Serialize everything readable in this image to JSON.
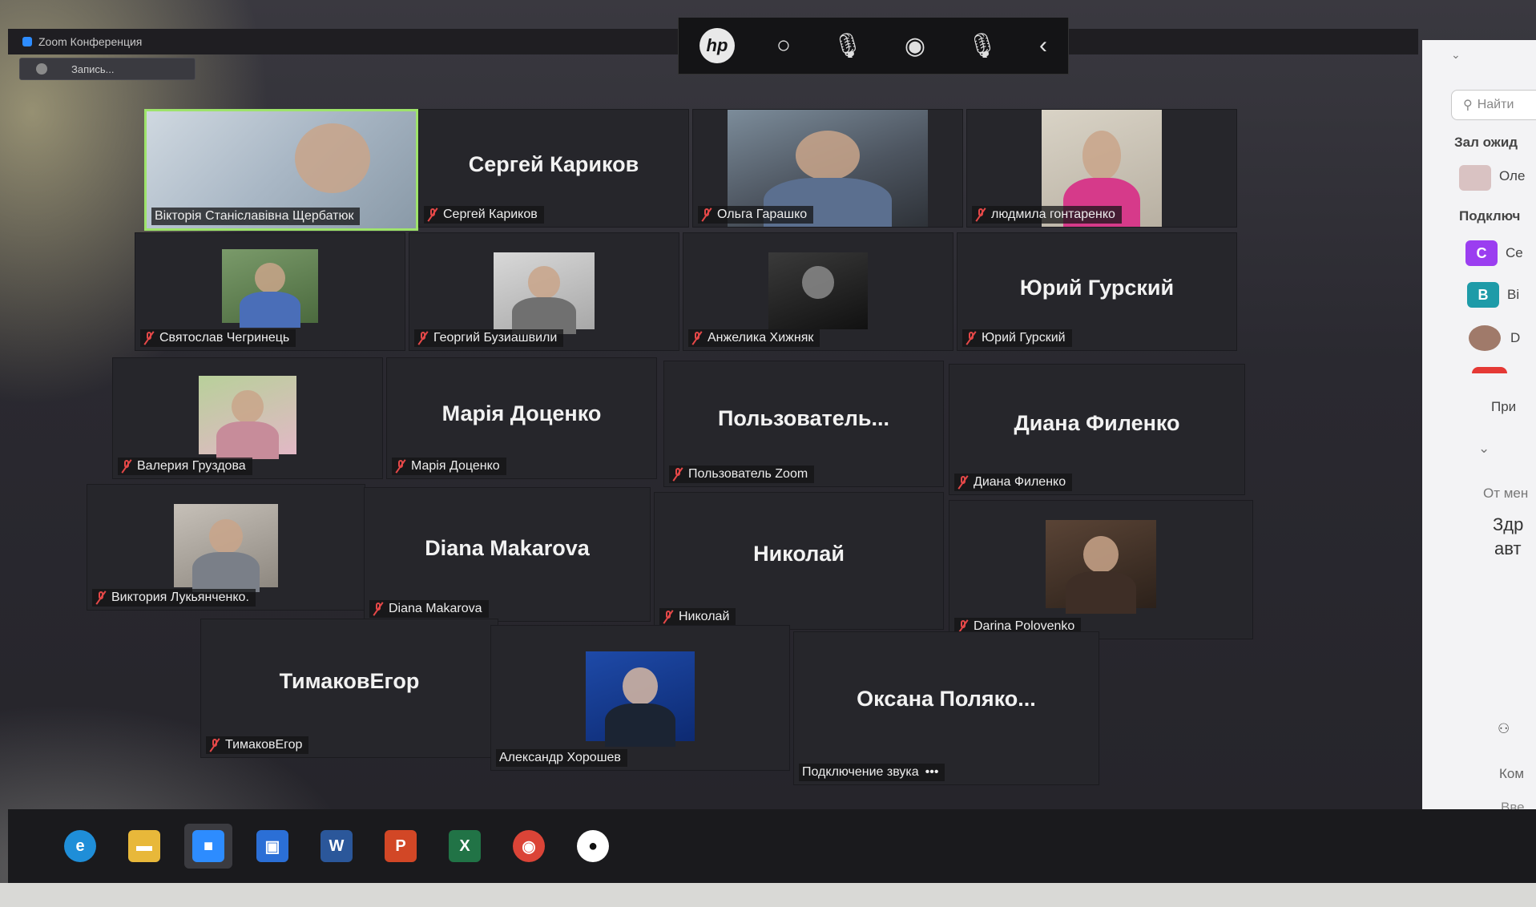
{
  "window": {
    "title": "Zoom Конференция",
    "recording_label": "Запись..."
  },
  "participants": [
    {
      "name": "Вікторія Станіславівна Щербатюк",
      "big_name": "",
      "has_video": true,
      "active_speaker": true,
      "muted": false
    },
    {
      "name": "Сергей Кариков",
      "big_name": "Сергей Кариков",
      "has_video": false,
      "muted": true
    },
    {
      "name": "Ольга Гарашко",
      "big_name": "",
      "has_video": true,
      "muted": true
    },
    {
      "name": "людмила гонтаренко",
      "big_name": "",
      "has_video": true,
      "muted": true
    },
    {
      "name": "Святослав Чегринець",
      "big_name": "",
      "has_video": true,
      "muted": true
    },
    {
      "name": "Георгий Бузиашвили",
      "big_name": "",
      "has_video": true,
      "muted": true
    },
    {
      "name": "Анжелика Хижняк",
      "big_name": "",
      "has_video": true,
      "muted": true
    },
    {
      "name": "Юрий Гурский",
      "big_name": "Юрий Гурский",
      "has_video": false,
      "muted": true
    },
    {
      "name": "Валерия Груздова",
      "big_name": "",
      "has_video": true,
      "muted": true
    },
    {
      "name": "Марія Доценко",
      "big_name": "Марія Доценко",
      "has_video": false,
      "muted": true
    },
    {
      "name": "Пользователь Zoom",
      "big_name": "Пользователь...",
      "has_video": false,
      "muted": true
    },
    {
      "name": "Диана Филенко",
      "big_name": "Диана Филенко",
      "has_video": false,
      "muted": true
    },
    {
      "name": "Виктория Лукьянченко.",
      "big_name": "",
      "has_video": true,
      "muted": true
    },
    {
      "name": "Diana Makarova",
      "big_name": "Diana Makarova",
      "has_video": false,
      "muted": true
    },
    {
      "name": "Николай",
      "big_name": "Николай",
      "has_video": false,
      "muted": true
    },
    {
      "name": "Darina Polovenko",
      "big_name": "",
      "has_video": true,
      "muted": true
    },
    {
      "name": "ТимаковЕгор",
      "big_name": "ТимаковЕгор",
      "has_video": false,
      "muted": true
    },
    {
      "name": "Александр Хорошев",
      "big_name": "",
      "has_video": true,
      "muted": false
    },
    {
      "name": "Подключение звука",
      "big_name": "Оксана Поляко...",
      "has_video": false,
      "muted": false,
      "suffix": "•••"
    }
  ],
  "side_panel": {
    "search_placeholder": "Найти",
    "waiting_room": "Зал ожид",
    "waiting_item": "Оле",
    "connected": "Подключ",
    "items": [
      {
        "initial": "C",
        "label": "Се",
        "color": "#9b3ef0"
      },
      {
        "initial": "B",
        "label": "Ві",
        "color": "#1e9ba8"
      },
      {
        "initial": "",
        "label": "D",
        "color": "#a07a6a"
      }
    ],
    "invite": "При",
    "from_me": "От мен",
    "message_line1": "Здр",
    "message_line2": "авт",
    "comment": "Ком",
    "enter": "Вве"
  },
  "taskbar": {
    "apps": [
      {
        "name": "edge-icon",
        "glyph": "e",
        "color": "#1f8ed8"
      },
      {
        "name": "file-explorer-icon",
        "glyph": "▬",
        "color": "#e8b83a"
      },
      {
        "name": "zoom-icon",
        "glyph": "■",
        "color": "#2d8cff"
      },
      {
        "name": "save-disk-icon",
        "glyph": "▣",
        "color": "#2b6fd6"
      },
      {
        "name": "word-icon",
        "glyph": "W",
        "color": "#2b579a"
      },
      {
        "name": "powerpoint-icon",
        "glyph": "P",
        "color": "#d24726"
      },
      {
        "name": "excel-icon",
        "glyph": "X",
        "color": "#217346"
      },
      {
        "name": "chrome-icon",
        "glyph": "◉",
        "color": "#db4437"
      },
      {
        "name": "obs-icon",
        "glyph": "●",
        "color": "#444444"
      }
    ]
  }
}
